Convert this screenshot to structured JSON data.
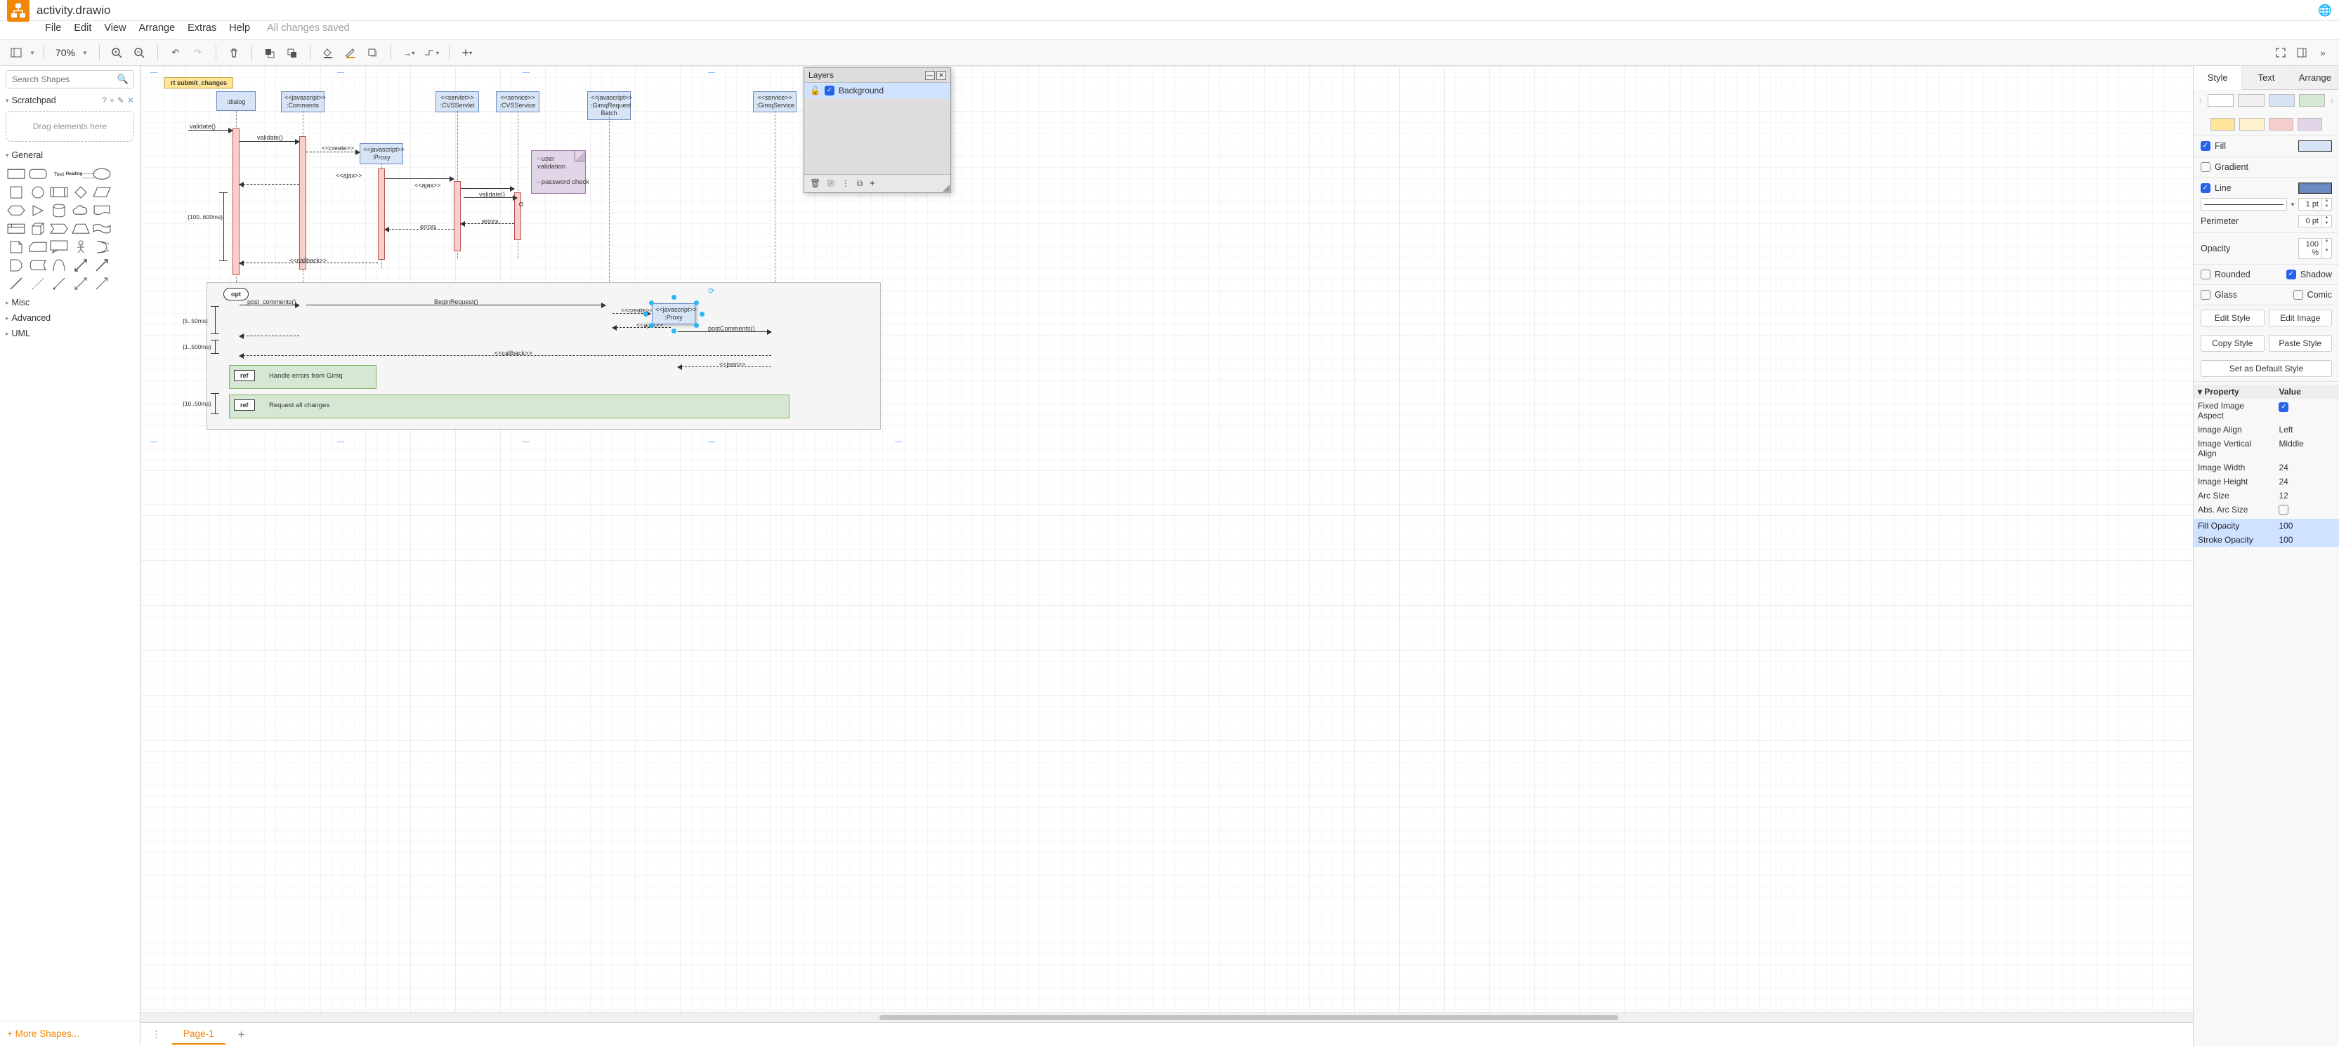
{
  "title": "activity.drawio",
  "menubar": [
    "File",
    "Edit",
    "View",
    "Arrange",
    "Extras",
    "Help"
  ],
  "status": "All changes saved",
  "zoom": "70%",
  "search_placeholder": "Search Shapes",
  "scratchpad_label": "Scratchpad",
  "scratchpad_hint": "Drag elements here",
  "shape_categories": [
    "General",
    "Misc",
    "Advanced",
    "UML"
  ],
  "more_shapes": "More Shapes...",
  "page_tab": "Page-1",
  "right_tabs": [
    "Style",
    "Text",
    "Arrange"
  ],
  "style_swatches_row1": [
    "#ffffff",
    "#f0f0f0",
    "#d7e4f5",
    "#d5e8d4"
  ],
  "style_swatches_row2": [
    "#ffe599",
    "#fff2cc",
    "#f8cecc",
    "#e1d5e7"
  ],
  "fill_label": "Fill",
  "gradient_label": "Gradient",
  "line_label": "Line",
  "line_width": "1 pt",
  "perimeter_label": "Perimeter",
  "perimeter_val": "0 pt",
  "opacity_label": "Opacity",
  "opacity_val": "100 %",
  "rounded_label": "Rounded",
  "shadow_label": "Shadow",
  "glass_label": "Glass",
  "comic_label": "Comic",
  "edit_style": "Edit Style",
  "edit_image": "Edit Image",
  "copy_style": "Copy Style",
  "paste_style": "Paste Style",
  "default_style": "Set as Default Style",
  "prop_header": {
    "p": "Property",
    "v": "Value"
  },
  "properties": [
    {
      "p": "Fixed Image Aspect",
      "v": "",
      "checked": true
    },
    {
      "p": "Image Align",
      "v": "Left"
    },
    {
      "p": "Image Vertical Align",
      "v": "Middle"
    },
    {
      "p": "Image Width",
      "v": "24"
    },
    {
      "p": "Image Height",
      "v": "24"
    },
    {
      "p": "Arc Size",
      "v": "12"
    },
    {
      "p": "Abs. Arc Size",
      "v": "",
      "checked": false
    },
    {
      "p": "Fill Opacity",
      "v": "100",
      "sel": true
    },
    {
      "p": "Stroke Opacity",
      "v": "100",
      "sel": true
    }
  ],
  "layers": {
    "title": "Layers",
    "row": "Background"
  },
  "diagram": {
    "frag_title": "rt submit_changes",
    "heads": {
      "dialog": ":dialog",
      "comments": "<<javascript>>\n:Comments",
      "servlet": "<<servlet>>\n:CVSServlet",
      "cvsservice": "<<service>>\n:CVSService",
      "gimqbatch": "<<javascript>>\n:GimqRequest\nBatch",
      "gimqservice": "<<service>>\n:GimqService",
      "proxy1": "<<javascript>>\n:Proxy",
      "proxy2": "<<javascript>>\n:Proxy"
    },
    "messages": {
      "validate1": "validate()",
      "validate2": "validate()",
      "create": "<<create>>",
      "ajax1": "<<ajax>>",
      "ajax2": "<<ajax>>",
      "validate3": "validate()",
      "errors1": "errors",
      "errors2": "errors",
      "callback1": "<<callback>>",
      "post_comments": "post_comments()",
      "begin_request": "BeginRequest()",
      "create2": "<<create>>",
      "ajax3": "<<ajax>>",
      "post_comments2": "postComments()",
      "callback2": "<<callback>>",
      "json": "<<json>>"
    },
    "opt": "opt",
    "note": "- user\nvalidation\n\n- password check",
    "durations": {
      "d1": "{100..600ms}",
      "d2": "{5..50ms}",
      "d3": "{1..500ms}",
      "d4": "{10..50ms}"
    },
    "ref1_tag": "ref",
    "ref1_text": "Handle errors from Gimq",
    "ref2_tag": "ref",
    "ref2_text": "Request all changes"
  }
}
